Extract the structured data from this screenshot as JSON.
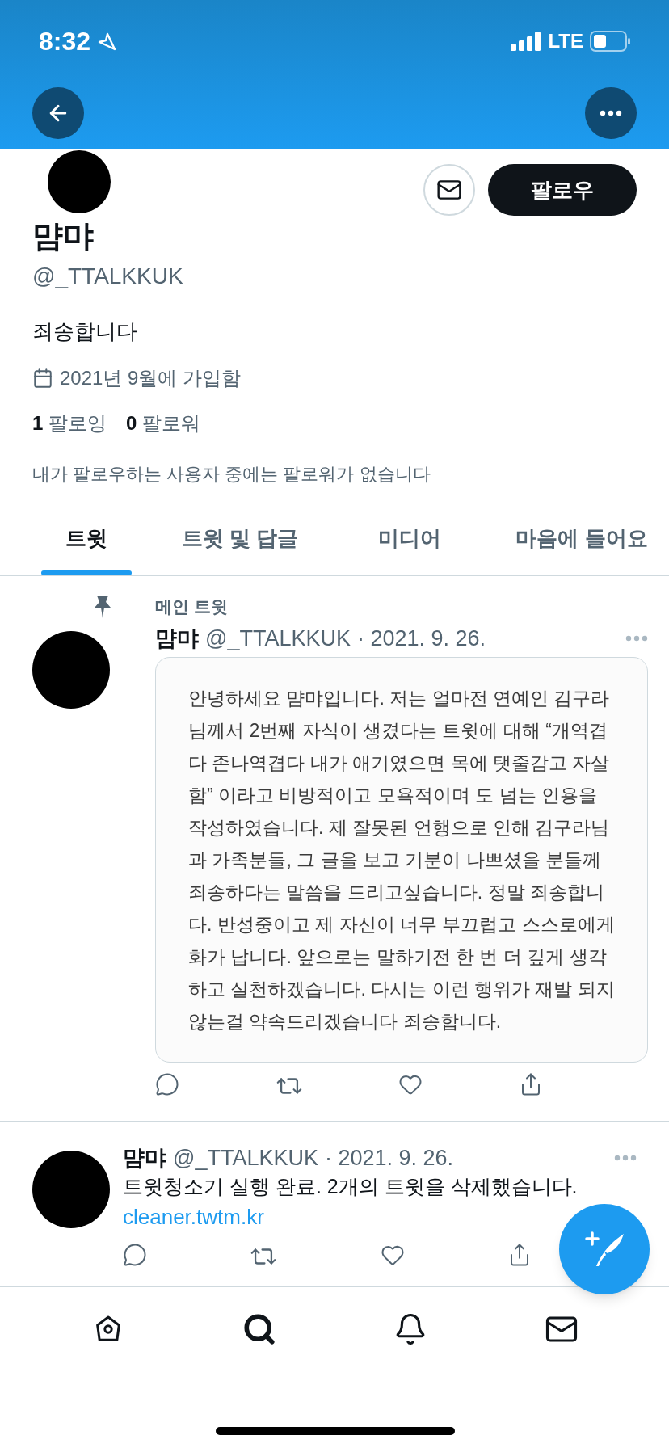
{
  "status_bar": {
    "time": "8:32",
    "network": "LTE"
  },
  "profile": {
    "name": "먐먀",
    "handle": "@_TTALKKUK",
    "bio": "죄송합니다",
    "joined": "2021년 9월에 가입함",
    "following_count": "1",
    "following_label": "팔로잉",
    "followers_count": "0",
    "followers_label": "팔로워",
    "mutuals_note": "내가 팔로우하는 사용자 중에는 팔로워가 없습니다",
    "follow_button": "팔로우"
  },
  "tabs": [
    {
      "label": "트윗",
      "selected": true
    },
    {
      "label": "트윗 및 답글",
      "selected": false
    },
    {
      "label": "미디어",
      "selected": false
    },
    {
      "label": "마음에 들어요",
      "selected": false
    }
  ],
  "tweets": [
    {
      "pinned_label": "메인 트윗",
      "name": "먐먀",
      "handle": "@_TTALKKUK",
      "date": "· 2021. 9. 26.",
      "image_text": [
        "안녕하세요 먐먀입니다. 저는 얼마전 연예인 김구라",
        "님께서 2번째 자식이 생겼다는 트윗에 대해 “개역겹",
        "다 존나역겹다 내가 애기였으면 목에 탯줄감고 자살",
        "함” 이라고 비방적이고 모욕적이며 도 넘는 인용을",
        "작성하였습니다. 제 잘못된 언행으로 인해 김구라님",
        "과 가족분들, 그 글을 보고 기분이 나쁘셨을 분들께",
        "죄송하다는 말씀을 드리고싶습니다. 정말 죄송합니",
        "다. 반성중이고 제 자신이 너무 부끄럽고 스스로에게",
        "화가 납니다. 앞으로는 말하기전 한 번 더 깊게 생각",
        "하고 실천하겠습니다. 다시는 이런 행위가 재발 되지",
        "않는걸 약속드리겠습니다 죄송합니다."
      ]
    },
    {
      "name": "먐먀",
      "handle": "@_TTALKKUK",
      "date": "· 2021. 9. 26.",
      "text": "트윗청소기 실행 완료. 2개의 트윗을 삭제했습니다.",
      "link": "cleaner.twtm.kr"
    }
  ],
  "bottom_nav": [
    {
      "kind": "home",
      "selected": false
    },
    {
      "kind": "search",
      "selected": true
    },
    {
      "kind": "notifications",
      "selected": false
    },
    {
      "kind": "messages",
      "selected": false
    }
  ]
}
